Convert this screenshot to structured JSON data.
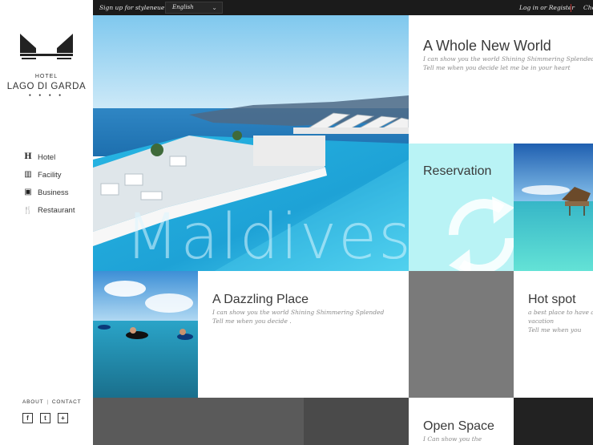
{
  "topbar": {
    "signup": "Sign up for styleneue",
    "language": "English",
    "login": "Log in or Register",
    "extra": "Che"
  },
  "sidebar": {
    "hotel_word": "HOTEL",
    "hotel_name": "LAGO DI GARDA",
    "stars": "● ● ● ●",
    "nav": [
      {
        "icon": "H",
        "label": "Hotel"
      },
      {
        "icon": "▥",
        "label": "Facility"
      },
      {
        "icon": "▣",
        "label": "Business"
      },
      {
        "icon": "🍴",
        "label": "Restaurant"
      }
    ],
    "footer": {
      "about": "ABOUT",
      "sep": "|",
      "contact": "CONTACT"
    },
    "social": [
      "f",
      "t",
      "+"
    ]
  },
  "tiles": {
    "hero": {
      "word": "Maldives"
    },
    "world": {
      "title": "A Whole New World",
      "line1": "I can show you the world  Shining Shimmering Splended",
      "line2": "Tell me when you decide let me be in your heart"
    },
    "reservation": {
      "title": "Reservation"
    },
    "dazzling": {
      "title": "A Dazzling Place",
      "line1": "I can show you the world  Shining Shimmering Splended",
      "line2": "Tell me when you decide ."
    },
    "hotspot": {
      "title": "Hot spot",
      "line1": "a best place to have a",
      "line2": "vacation",
      "line3": "Tell me when you"
    },
    "openspace": {
      "title": "Open Space",
      "line1": "I Can show you the"
    }
  },
  "colors": {
    "topbar": "#1b1b1b",
    "reservation_bg": "#b9f3f5",
    "gray_tile": "#7a7a7a",
    "dark_tile": "#4a4a4a"
  }
}
